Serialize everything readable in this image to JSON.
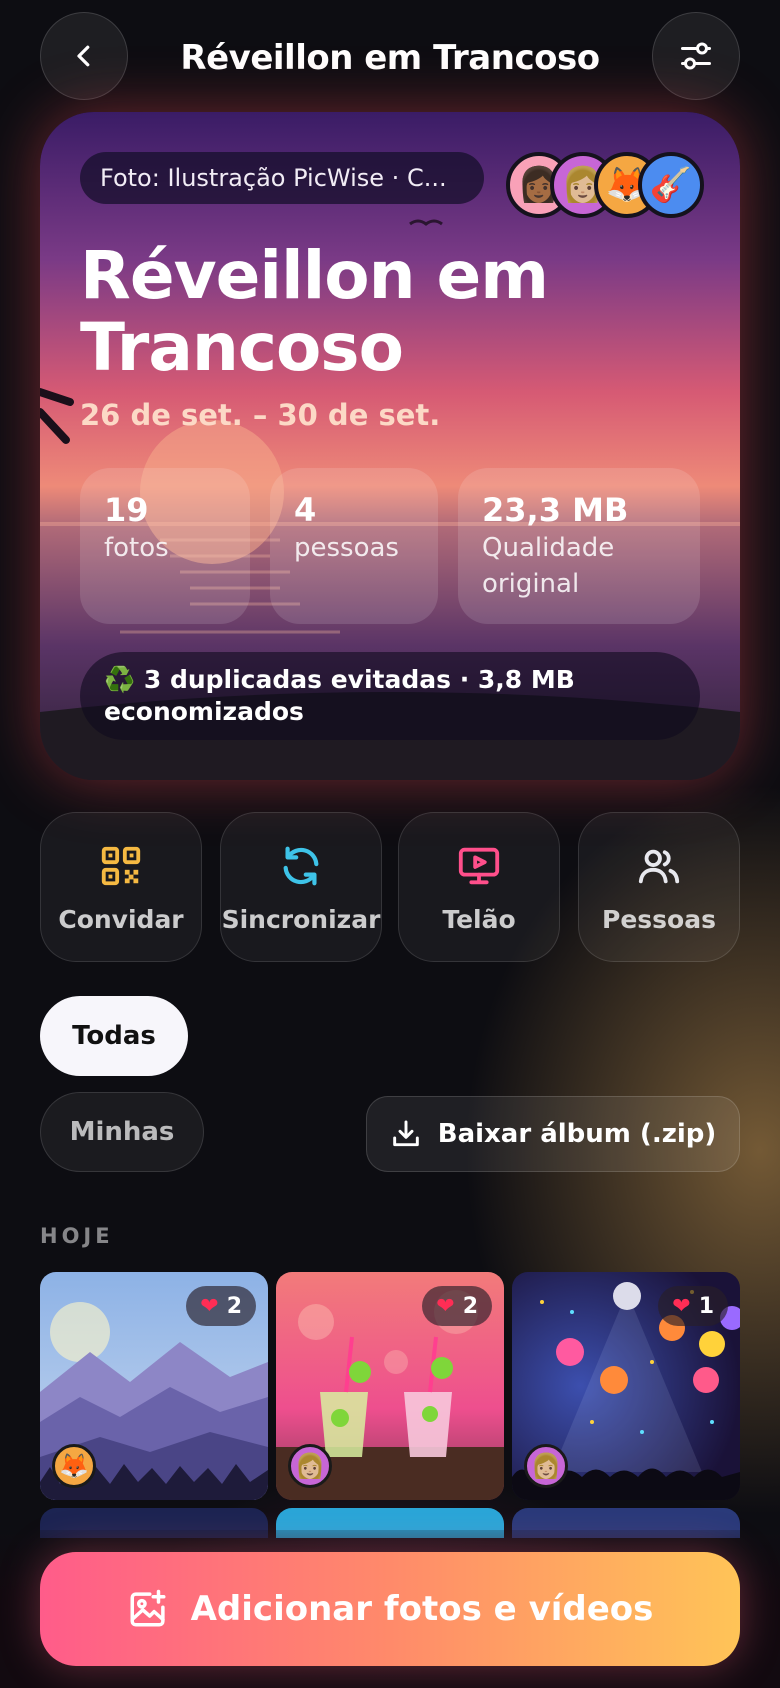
{
  "header": {
    "title": "Réveillon em Trancoso",
    "back_icon": "chevron-left-icon",
    "settings_icon": "sliders-icon"
  },
  "hero": {
    "credit": "Foto: Ilustração PicWise · C...",
    "title": "Réveillon em Trancoso",
    "dates": "26 de set. – 30 de set.",
    "avatars": [
      "👩🏾",
      "👩🏼",
      "🦊",
      "🎸"
    ],
    "stats": [
      {
        "value": "19",
        "label": "fotos"
      },
      {
        "value": "4",
        "label": "pessoas"
      },
      {
        "value": "23,3 MB",
        "label": "Qualidade original"
      }
    ],
    "duplicates_icon": "♻️",
    "duplicates_text": "3 duplicadas evitadas · 3,8 MB economizados"
  },
  "actions": [
    {
      "label": "Convidar",
      "icon": "qr-code-icon",
      "color": "#f5b942"
    },
    {
      "label": "Sincronizar",
      "icon": "sync-icon",
      "color": "#3ec3e8"
    },
    {
      "label": "Telão",
      "icon": "screen-play-icon",
      "color": "#ff4f8b"
    },
    {
      "label": "Pessoas",
      "icon": "people-icon",
      "color": "#e8e8ee"
    }
  ],
  "filters": {
    "all": "Todas",
    "mine": "Minhas",
    "download": "Baixar álbum (.zip)"
  },
  "section": "HOJE",
  "photos": [
    {
      "likes": "2",
      "avatar": "🦊"
    },
    {
      "likes": "2",
      "avatar": "👩🏼"
    },
    {
      "likes": "1",
      "avatar": "👩🏼"
    }
  ],
  "cta": {
    "label": "Adicionar fotos e vídeos"
  },
  "colors": {
    "cta_start": "#ff5c8a",
    "cta_end": "#ffc457",
    "background": "#0d0d12"
  }
}
